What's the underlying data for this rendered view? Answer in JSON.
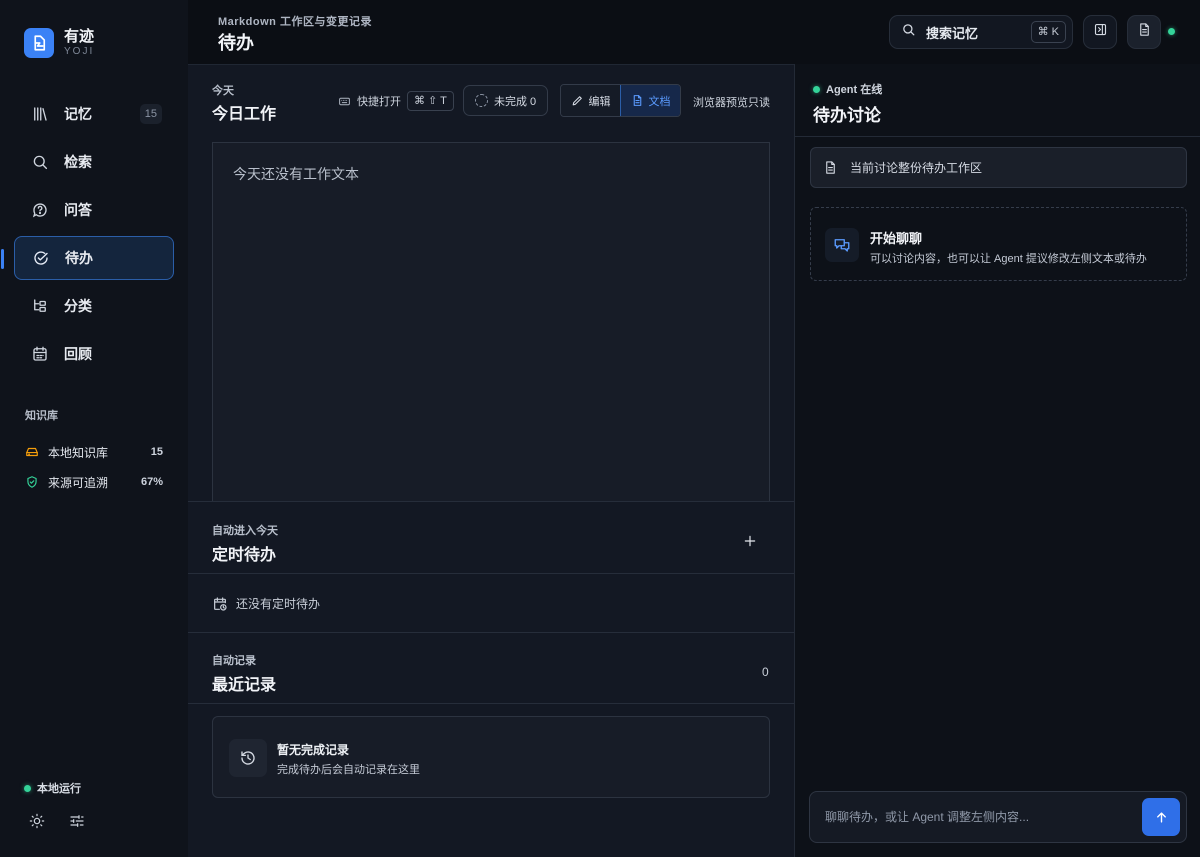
{
  "brand": {
    "name": "有迹",
    "subtitle": "YOJI"
  },
  "sidebar": {
    "items": [
      {
        "label": "记忆",
        "icon": "library-icon",
        "badge": "15"
      },
      {
        "label": "检索",
        "icon": "search-icon"
      },
      {
        "label": "问答",
        "icon": "question-circle-icon"
      },
      {
        "label": "待办",
        "icon": "check-circle-icon",
        "active": true
      },
      {
        "label": "分类",
        "icon": "tree-icon"
      },
      {
        "label": "回顾",
        "icon": "calendar-icon"
      }
    ],
    "kb_title": "知识库",
    "kb_rows": [
      {
        "label": "本地知识库",
        "value": "15",
        "icon": "drive-icon",
        "color": "#f59e0b"
      },
      {
        "label": "来源可追溯",
        "value": "67%",
        "icon": "shield-check-icon",
        "color": "#34d399"
      }
    ],
    "run_status": "本地运行"
  },
  "header": {
    "subtitle": "Markdown 工作区与变更记录",
    "title": "待办",
    "search_label": "搜索记忆",
    "search_shortcut": "⌘ K"
  },
  "today": {
    "kicker": "今天",
    "title": "今日工作",
    "quick_open_label": "快捷打开",
    "quick_open_keys": "⌘ ⇧ T",
    "incomplete_label": "未完成 0",
    "edit_label": "编辑",
    "doc_label": "文档",
    "readonly_note": "浏览器预览只读",
    "editor_placeholder": "今天还没有工作文本"
  },
  "scheduled": {
    "kicker": "自动进入今天",
    "title": "定时待办",
    "empty": "还没有定时待办"
  },
  "recent": {
    "kicker": "自动记录",
    "title": "最近记录",
    "count": "0",
    "empty_title": "暂无完成记录",
    "empty_desc": "完成待办后会自动记录在这里"
  },
  "discussion": {
    "status": "Agent 在线",
    "title": "待办讨论",
    "context": "当前讨论整份待办工作区",
    "start_title": "开始聊聊",
    "start_desc": "可以讨论内容，也可以让 Agent 提议修改左侧文本或待办",
    "input_placeholder": "聊聊待办，或让 Agent 调整左侧内容..."
  },
  "colors": {
    "accent": "#3b82f6",
    "online": "#34d399",
    "bg": "#0b0e14"
  }
}
